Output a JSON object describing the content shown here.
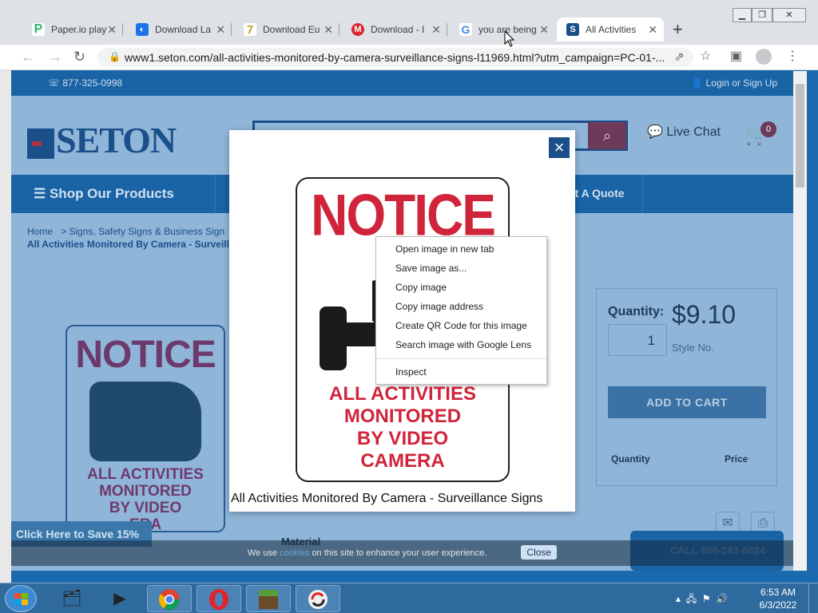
{
  "browser": {
    "tabs": [
      {
        "title": "Paper.io play",
        "icon": "paperio-icon",
        "color": "#2bb673",
        "glyph": "P"
      },
      {
        "title": "Download La",
        "icon": "download-icon",
        "color": "#1a73e8",
        "glyph": "◐"
      },
      {
        "title": "Download Eu",
        "icon": "seven-icon",
        "color": "#c69b2a",
        "glyph": "7"
      },
      {
        "title": "Download - I",
        "icon": "mega-icon",
        "color": "#d9272e",
        "glyph": "M"
      },
      {
        "title": "you are being",
        "icon": "google-icon",
        "color": "#4285f4",
        "glyph": "G"
      },
      {
        "title": "All Activities",
        "icon": "seton-icon",
        "color": "#1a4f8a",
        "glyph": "S",
        "active": true
      }
    ],
    "url": "www1.seton.com/all-activities-monitored-by-camera-surveillance-signs-l11969.html?utm_campaign=PC-01-..."
  },
  "site": {
    "phone": "877-325-0998",
    "login": "Login or Sign Up",
    "logo": "SETON",
    "live_chat": "Live Chat",
    "cart_count": "0",
    "shop_products": "Shop Our Products",
    "request_quote": "est A Quote",
    "breadcrumb_home": "Home",
    "breadcrumb_sep": ">",
    "breadcrumb_cat": "Signs, Safety Signs & Business Sign",
    "breadcrumb_current": "All Activities Monitored By Camera - Surveill",
    "product_notice": "NOTICE",
    "product_lines": [
      "ALL ACTIVITIES",
      "MONITORED",
      "BY VIDEO",
      "ERA"
    ],
    "save_banner": "Click Here to Save 15%",
    "quantity_label": "Quantity:",
    "quantity_value": "1",
    "price": "$9.10",
    "style_no": "Style No.",
    "add_to_cart": "ADD TO CART",
    "table_quantity": "Quantity",
    "table_price": "Price",
    "material_label": "Material",
    "call_label": "CALL 800-243-6624",
    "cookie_text_before": "We use",
    "cookie_link": "cookies",
    "cookie_text_after": "on this site to enhance your user experience.",
    "cookie_close": "Close"
  },
  "modal": {
    "close": "×",
    "sign_notice": "NOTICE",
    "sign_lines": [
      "ALL ACTIVITIES",
      "MONITORED",
      "BY VIDEO",
      "CAMERA"
    ],
    "caption": "All Activities Monitored By Camera - Surveillance Signs"
  },
  "context_menu": {
    "items": [
      "Open image in new tab",
      "Save image as...",
      "Copy image",
      "Copy image address",
      "Create QR Code for this image",
      "Search image with Google Lens"
    ],
    "inspect": "Inspect"
  },
  "taskbar": {
    "time": "6:53 AM",
    "date": "6/3/2022"
  },
  "colors": {
    "seton_blue": "#1a63a4",
    "notice_red": "#d0243b"
  }
}
